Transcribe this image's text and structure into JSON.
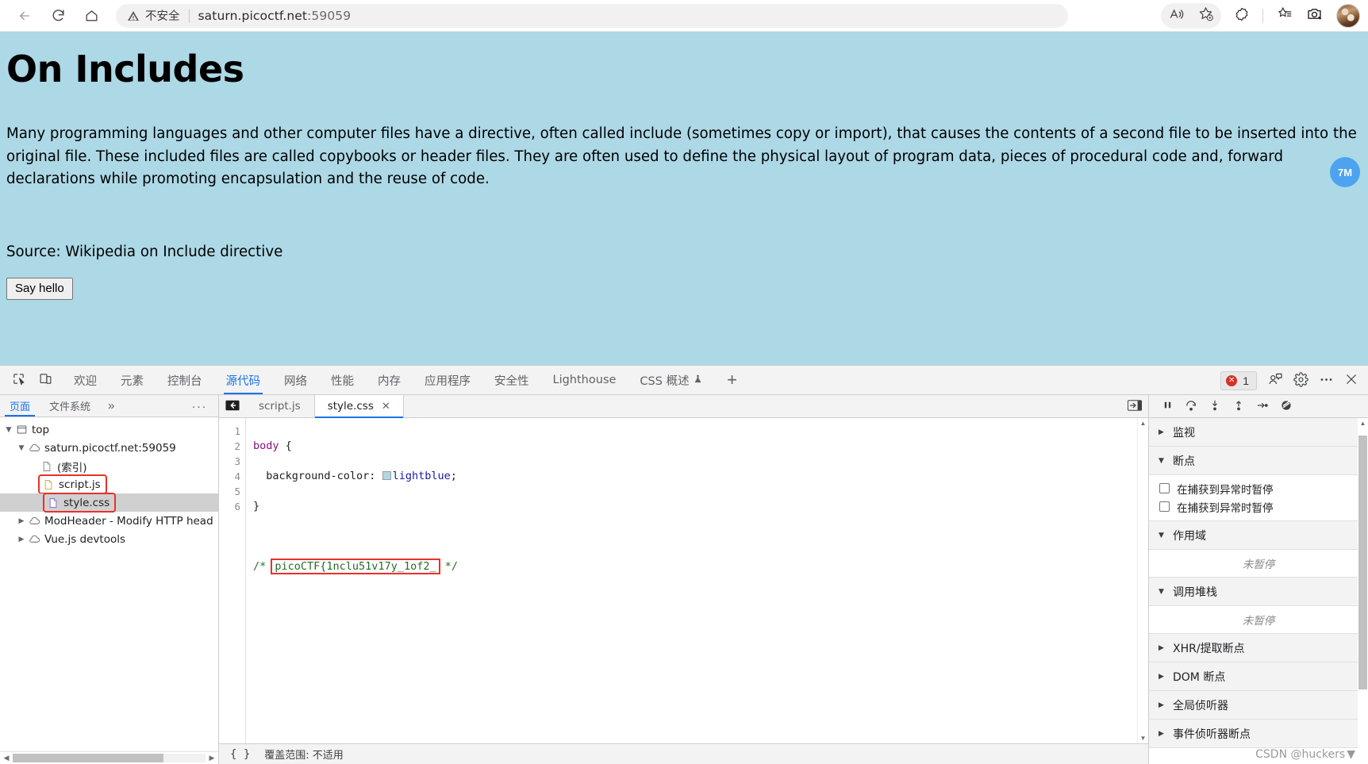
{
  "browser": {
    "nav": {
      "back_icon": "arrow-left-icon",
      "reload_icon": "reload-icon",
      "home_icon": "home-icon"
    },
    "address": {
      "security_label": "不安全",
      "warn_icon": "warning-triangle-icon",
      "url_host": "saturn.picoctf.net",
      "url_port": ":59059"
    },
    "right_icons": [
      {
        "name": "read-aloud-icon",
        "label": "A))"
      },
      {
        "name": "add-favorite-icon",
        "label": "star-plus"
      },
      {
        "name": "browser-essentials-icon",
        "label": "essentials"
      },
      {
        "name": "favorites-list-icon",
        "label": "star-list"
      },
      {
        "name": "screenshot-icon",
        "label": "camera"
      }
    ],
    "avatar": "profile-avatar"
  },
  "page": {
    "background_color": "#add8e6",
    "title": "On Includes",
    "paragraph": "Many programming languages and other computer files have a directive, often called include (sometimes copy or import), that causes the contents of a second file to be inserted into the original file. These included files are called copybooks or header files. They are often used to define the physical layout of program data, pieces of procedural code and, forward declarations while promoting encapsulation and the reuse of code.",
    "source_line": "Source: Wikipedia on Include directive",
    "button_label": "Say hello",
    "floating_badge": "7M"
  },
  "devtools": {
    "tool_icons": [
      {
        "name": "inspect-element-icon"
      },
      {
        "name": "device-toolbar-icon"
      }
    ],
    "tabs": [
      {
        "label": "欢迎",
        "active": false
      },
      {
        "label": "元素",
        "active": false
      },
      {
        "label": "控制台",
        "active": false
      },
      {
        "label": "源代码",
        "active": true
      },
      {
        "label": "网络",
        "active": false
      },
      {
        "label": "性能",
        "active": false
      },
      {
        "label": "内存",
        "active": false
      },
      {
        "label": "应用程序",
        "active": false
      },
      {
        "label": "安全性",
        "active": false
      },
      {
        "label": "Lighthouse",
        "active": false
      },
      {
        "label": "CSS 概述",
        "active": false,
        "beta_icon": "beaker-icon"
      }
    ],
    "add_tab": "+",
    "error_badge": {
      "count": "1",
      "icon": "error-circle-icon"
    },
    "right_icons": [
      {
        "name": "devtools-feedback-icon"
      },
      {
        "name": "settings-gear-icon"
      },
      {
        "name": "more-options-icon"
      },
      {
        "name": "close-devtools-icon"
      }
    ]
  },
  "navigator": {
    "tabs": [
      {
        "label": "页面",
        "active": true
      },
      {
        "label": "文件系统",
        "active": false
      }
    ],
    "more_tabs": "»",
    "menu": "···",
    "tree": [
      {
        "label": "top",
        "depth": 0,
        "twisty": "▼",
        "icon": "frame-icon",
        "selected": false,
        "highlighted": false
      },
      {
        "label": "saturn.picoctf.net:59059",
        "depth": 1,
        "twisty": "▼",
        "icon": "cloud-icon",
        "selected": false,
        "highlighted": false
      },
      {
        "label": "(索引)",
        "depth": 2,
        "twisty": "",
        "icon": "document-icon",
        "selected": false,
        "highlighted": false
      },
      {
        "label": "script.js",
        "depth": 2,
        "twisty": "",
        "icon": "js-file-icon",
        "selected": false,
        "highlighted": true
      },
      {
        "label": "style.css",
        "depth": 2,
        "twisty": "",
        "icon": "css-file-icon",
        "selected": true,
        "highlighted": true
      },
      {
        "label": "ModHeader - Modify HTTP head",
        "depth": 1,
        "twisty": "▶",
        "icon": "cloud-icon",
        "selected": false,
        "highlighted": false
      },
      {
        "label": "Vue.js devtools",
        "depth": 1,
        "twisty": "▶",
        "icon": "cloud-icon",
        "selected": false,
        "highlighted": false
      }
    ]
  },
  "editor": {
    "back_icon": "jump-to-source-icon",
    "tabs": [
      {
        "label": "script.js",
        "active": false,
        "closable": false
      },
      {
        "label": "style.css",
        "active": true,
        "closable": true,
        "close_icon": "close-icon"
      }
    ],
    "show_drawer_icon": "show-navigator-icon",
    "line_numbers": [
      "1",
      "2",
      "3",
      "4",
      "5",
      "6"
    ],
    "code": {
      "line1_selector": "body",
      "line1_brace": " {",
      "line2_indent": "  ",
      "line2_property": "background-color:",
      "line2_swatch": "color-swatch-lightblue",
      "line2_value": "lightblue",
      "line2_semi": ";",
      "line3": "}",
      "line4": "",
      "line5_comment_open": "/* ",
      "line5_flag": "picoCTF{1nclu51v17y_1of2_",
      "line5_comment_close": " */",
      "line6": ""
    },
    "statusbar": {
      "pretty_print": "{ }",
      "coverage": "覆盖范围: 不适用"
    }
  },
  "debugger": {
    "toolbar": [
      {
        "name": "pause-resume-icon"
      },
      {
        "name": "step-over-icon"
      },
      {
        "name": "step-into-icon"
      },
      {
        "name": "step-out-icon"
      },
      {
        "name": "step-icon"
      },
      {
        "name": "deactivate-breakpoints-icon"
      }
    ],
    "sections": [
      {
        "title": "监视",
        "arrow": "▶",
        "expanded": false
      },
      {
        "title": "断点",
        "arrow": "▼",
        "expanded": true
      },
      {
        "title": "作用域",
        "arrow": "▼",
        "expanded": true
      },
      {
        "title": "调用堆栈",
        "arrow": "▼",
        "expanded": true
      },
      {
        "title": "XHR/提取断点",
        "arrow": "▶",
        "expanded": false
      },
      {
        "title": "DOM 断点",
        "arrow": "▶",
        "expanded": false
      },
      {
        "title": "全局侦听器",
        "arrow": "▶",
        "expanded": false
      },
      {
        "title": "事件侦听器断点",
        "arrow": "▶",
        "expanded": false
      }
    ],
    "breakpoint_options": [
      "在捕获到异常时暂停",
      "在捕获到异常时暂停"
    ],
    "scope_empty": "未暂停",
    "callstack_empty": "未暂停"
  },
  "watermark": "CSDN @huckers",
  "colors": {
    "accent": "#1a73e8",
    "error": "#d93025",
    "highlight_box": "#e8312a",
    "page_bg": "#add8e6",
    "badge_blue": "#4da3ef"
  }
}
